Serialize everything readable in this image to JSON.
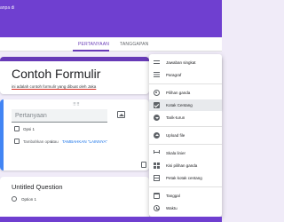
{
  "header": {
    "doc_title": "anpa di",
    "accent_color": "#6f3fd0"
  },
  "tabs": [
    {
      "label": "PERTANYAAN",
      "active": true
    },
    {
      "label": "TANGGAPAN",
      "active": false
    }
  ],
  "form": {
    "title": "Contoh Formulir",
    "description": "ini adalah contoh formulir yang dibuat oleh Jaka"
  },
  "question": {
    "placeholder": "Pertanyaan",
    "option_1": "Opsi 1",
    "add_option": "Tambahkan opsi",
    "add_option_sep": " atau ",
    "add_other": "TAMBAHKAN \"LAINNYA\""
  },
  "question2": {
    "title": "Untitled Question",
    "option_1": "Option 1"
  },
  "type_menu": {
    "items": [
      {
        "label": "Jawaban singkat",
        "icon": "short-answer-icon",
        "selected": false
      },
      {
        "label": "Paragraf",
        "icon": "paragraph-icon",
        "selected": false
      },
      {
        "label": "Pilihan ganda",
        "icon": "radio-icon",
        "selected": false
      },
      {
        "label": "Kotak Centang",
        "icon": "checkbox-icon",
        "selected": true
      },
      {
        "label": "Tarik-turun",
        "icon": "dropdown-icon",
        "selected": false
      },
      {
        "label": "Upload file",
        "icon": "upload-icon",
        "selected": false
      },
      {
        "label": "Skala linier",
        "icon": "linear-scale-icon",
        "selected": false
      },
      {
        "label": "Kisi pilihan ganda",
        "icon": "grid-icon",
        "selected": false
      },
      {
        "label": "Petak kotak centang",
        "icon": "checkbox-grid-icon",
        "selected": false
      },
      {
        "label": "Tanggal",
        "icon": "date-icon",
        "selected": false
      },
      {
        "label": "Waktu",
        "icon": "time-icon",
        "selected": false
      }
    ]
  }
}
